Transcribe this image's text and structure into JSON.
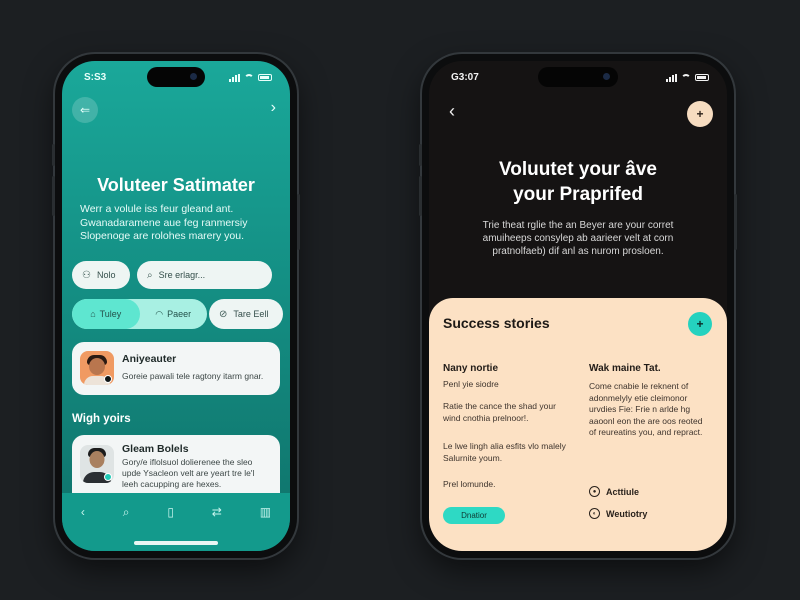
{
  "left_phone": {
    "status_time": "S:S3",
    "title": "Voluteer Satimater",
    "description": "Werr a volule iss feur gleand ant. Gwanadaramene aue feg ranmersiy Slopenoge are rolohes marery you.",
    "search_pills": [
      {
        "label": "Nolo",
        "icon": "user-icon"
      },
      {
        "label": "Sre erlagr...",
        "icon": "search-icon"
      }
    ],
    "segment": [
      {
        "label": "Tuley",
        "icon": "pin-icon",
        "active": true
      },
      {
        "label": "Paeer",
        "icon": "bag-icon",
        "active": false
      }
    ],
    "extra_pill": {
      "label": "Tare Eell",
      "icon": "tag-icon"
    },
    "card1": {
      "title": "Aniyeauter",
      "text": "Goreie pawali tele ragtony itarm gnar."
    },
    "section_label": "Wigh yoirs",
    "card2": {
      "title": "Gleam Bolels",
      "text": "Gory/e iflolsuol dolierenee the sleo upde Ysacleon velt are yeart tre le'l leeh cacupping are hexes."
    },
    "tabbar": [
      "back-icon",
      "search-icon",
      "calendar-icon",
      "shuffle-icon",
      "chart-icon"
    ]
  },
  "right_phone": {
    "status_time": "G3:07",
    "title_line1": "Voluutet your âve",
    "title_line2": "your Praprifed",
    "description": "Trie theat rglie the an Beyer are your corret amuiheeps consylep ab aarieer velt at corn pratnolfaeb) dif anl as nurom prosloen.",
    "sheet_title": "Success stories",
    "col1": {
      "title": "Nany nortie",
      "subtitle": "Penl yie siodre",
      "text1": "Ratie the cance the shad your wind cnothia prelnoor!.",
      "text2": "Le lwe lingh alia esfits vlo malely Salurnite youm.",
      "text3": "Prel lomunde.",
      "tag": "Dnatior"
    },
    "col2": {
      "title": "Wak maine Tat.",
      "text": "Come cnabie le reknent of adonmelyly etie cleimonor urvdies Fie: Frie n arlde hg aaoonl eon the are oos reoted of reureatins you, and repract.",
      "stat1": "Acttiule",
      "stat2": "Weutiotry"
    }
  },
  "colors": {
    "background": "#1c1f22",
    "teal_accent": "#25d2bf",
    "peach_sheet": "#fce1c4"
  }
}
